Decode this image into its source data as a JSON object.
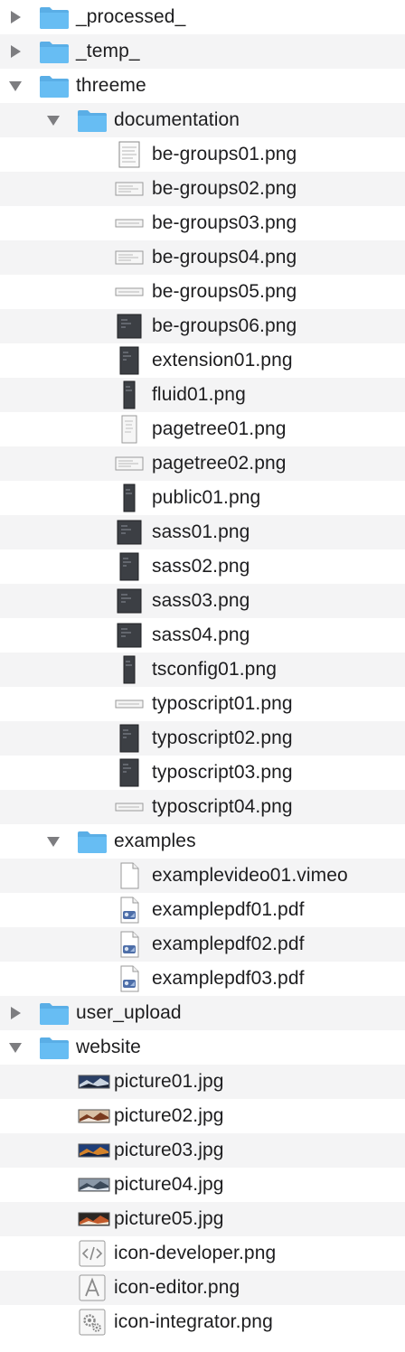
{
  "tree": [
    {
      "label": "_processed_",
      "depth": 0,
      "kind": "folder",
      "expandable": true,
      "expanded": false
    },
    {
      "label": "_temp_",
      "depth": 0,
      "kind": "folder",
      "expandable": true,
      "expanded": false
    },
    {
      "label": "threeme",
      "depth": 0,
      "kind": "folder",
      "expandable": true,
      "expanded": true
    },
    {
      "label": "documentation",
      "depth": 1,
      "kind": "folder",
      "expandable": true,
      "expanded": true
    },
    {
      "label": "be-groups01.png",
      "depth": 2,
      "kind": "file",
      "icon": "png-page-icon"
    },
    {
      "label": "be-groups02.png",
      "depth": 2,
      "kind": "file",
      "icon": "png-wide-light-icon"
    },
    {
      "label": "be-groups03.png",
      "depth": 2,
      "kind": "file",
      "icon": "png-strip-icon"
    },
    {
      "label": "be-groups04.png",
      "depth": 2,
      "kind": "file",
      "icon": "png-wide-light-icon"
    },
    {
      "label": "be-groups05.png",
      "depth": 2,
      "kind": "file",
      "icon": "png-strip-icon"
    },
    {
      "label": "be-groups06.png",
      "depth": 2,
      "kind": "file",
      "icon": "png-dark-square-icon"
    },
    {
      "label": "extension01.png",
      "depth": 2,
      "kind": "file",
      "icon": "png-dark-tall-icon"
    },
    {
      "label": "fluid01.png",
      "depth": 2,
      "kind": "file",
      "icon": "png-dark-narrow-icon"
    },
    {
      "label": "pagetree01.png",
      "depth": 2,
      "kind": "file",
      "icon": "png-light-tall-icon"
    },
    {
      "label": "pagetree02.png",
      "depth": 2,
      "kind": "file",
      "icon": "png-wide-light-icon"
    },
    {
      "label": "public01.png",
      "depth": 2,
      "kind": "file",
      "icon": "png-dark-narrow-icon"
    },
    {
      "label": "sass01.png",
      "depth": 2,
      "kind": "file",
      "icon": "png-dark-square-icon"
    },
    {
      "label": "sass02.png",
      "depth": 2,
      "kind": "file",
      "icon": "png-dark-tall-icon"
    },
    {
      "label": "sass03.png",
      "depth": 2,
      "kind": "file",
      "icon": "png-dark-square-icon"
    },
    {
      "label": "sass04.png",
      "depth": 2,
      "kind": "file",
      "icon": "png-dark-square-icon"
    },
    {
      "label": "tsconfig01.png",
      "depth": 2,
      "kind": "file",
      "icon": "png-dark-narrow-icon"
    },
    {
      "label": "typoscript01.png",
      "depth": 2,
      "kind": "file",
      "icon": "png-strip-icon"
    },
    {
      "label": "typoscript02.png",
      "depth": 2,
      "kind": "file",
      "icon": "png-dark-tall-icon"
    },
    {
      "label": "typoscript03.png",
      "depth": 2,
      "kind": "file",
      "icon": "png-dark-tall-icon"
    },
    {
      "label": "typoscript04.png",
      "depth": 2,
      "kind": "file",
      "icon": "png-strip-icon"
    },
    {
      "label": "examples",
      "depth": 1,
      "kind": "folder",
      "expandable": true,
      "expanded": true
    },
    {
      "label": "examplevideo01.vimeo",
      "depth": 2,
      "kind": "file",
      "icon": "blank-document-icon"
    },
    {
      "label": "examplepdf01.pdf",
      "depth": 2,
      "kind": "file",
      "icon": "pdf-document-icon"
    },
    {
      "label": "examplepdf02.pdf",
      "depth": 2,
      "kind": "file",
      "icon": "pdf-document-icon"
    },
    {
      "label": "examplepdf03.pdf",
      "depth": 2,
      "kind": "file",
      "icon": "pdf-document-icon"
    },
    {
      "label": "user_upload",
      "depth": 0,
      "kind": "folder",
      "expandable": true,
      "expanded": false
    },
    {
      "label": "website",
      "depth": 0,
      "kind": "folder",
      "expandable": true,
      "expanded": true
    },
    {
      "label": "picture01.jpg",
      "depth": 1,
      "kind": "file",
      "icon": "jpg-photo-icon",
      "photo_colors": [
        "#2a3f66",
        "#c9d3e0",
        "#1a2233"
      ]
    },
    {
      "label": "picture02.jpg",
      "depth": 1,
      "kind": "file",
      "icon": "jpg-photo-icon",
      "photo_colors": [
        "#d9c1a6",
        "#7a3b1f",
        "#efe6dc"
      ]
    },
    {
      "label": "picture03.jpg",
      "depth": 1,
      "kind": "file",
      "icon": "jpg-photo-icon",
      "photo_colors": [
        "#1f3e78",
        "#d4832b",
        "#112244"
      ]
    },
    {
      "label": "picture04.jpg",
      "depth": 1,
      "kind": "file",
      "icon": "jpg-photo-icon",
      "photo_colors": [
        "#8a98a8",
        "#3c4a5a",
        "#dfe6ee"
      ]
    },
    {
      "label": "picture05.jpg",
      "depth": 1,
      "kind": "file",
      "icon": "jpg-photo-icon",
      "photo_colors": [
        "#2a2623",
        "#c25a2a",
        "#f1e3d0"
      ]
    },
    {
      "label": "icon-developer.png",
      "depth": 1,
      "kind": "file",
      "icon": "code-tag-icon"
    },
    {
      "label": "icon-editor.png",
      "depth": 1,
      "kind": "file",
      "icon": "letter-a-icon"
    },
    {
      "label": "icon-integrator.png",
      "depth": 1,
      "kind": "file",
      "icon": "gears-icon"
    }
  ],
  "colors": {
    "folder_fill": "#67bdf3",
    "folder_tab": "#5aaee6",
    "text": "#1d1d1f",
    "stripe": "#f4f4f5",
    "disclosure": "#7d7d80"
  }
}
